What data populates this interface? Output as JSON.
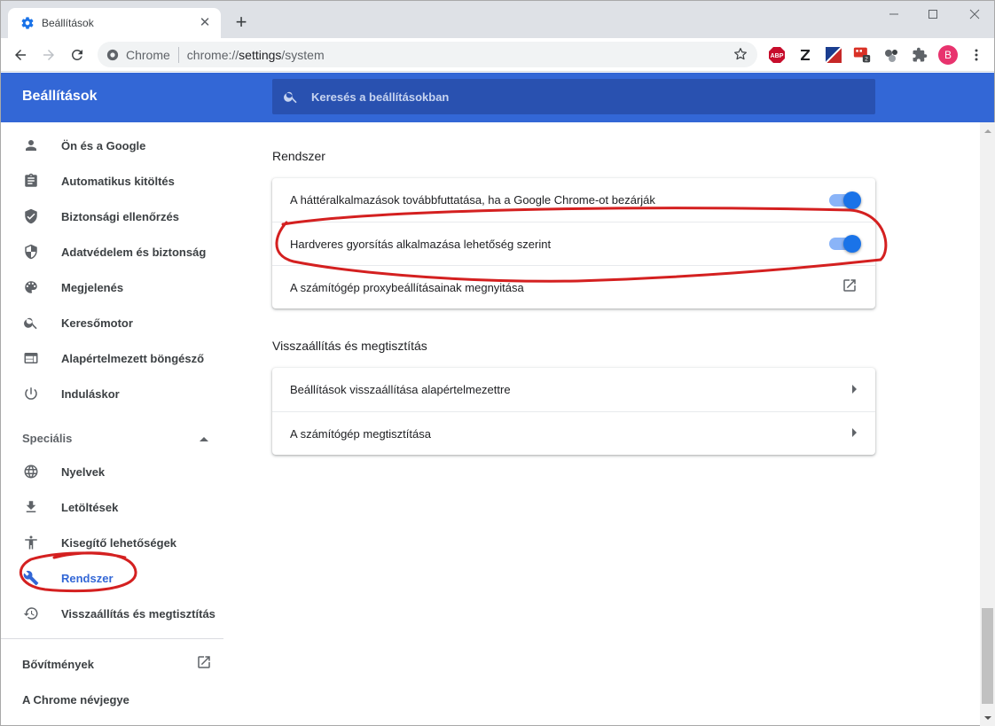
{
  "browser": {
    "tab_title": "Beállítások",
    "omnibox": {
      "site_label": "Chrome",
      "url_scheme": "chrome://",
      "url_host": "settings",
      "url_path": "/system"
    },
    "extensions": [
      "abp-icon",
      "zotero-icon",
      "flag-icon",
      "counter-icon",
      "dots-icon",
      "puzzle-icon"
    ],
    "ext_badge": "2",
    "avatar_letter": "B"
  },
  "header": {
    "title": "Beállítások",
    "search_placeholder": "Keresés a beállításokban"
  },
  "sidebar": {
    "items": [
      {
        "label": "Ön és a Google",
        "icon": "person-icon"
      },
      {
        "label": "Automatikus kitöltés",
        "icon": "clipboard-icon"
      },
      {
        "label": "Biztonsági ellenőrzés",
        "icon": "shield-check-icon"
      },
      {
        "label": "Adatvédelem és biztonság",
        "icon": "shield-icon"
      },
      {
        "label": "Megjelenés",
        "icon": "palette-icon"
      },
      {
        "label": "Keresőmotor",
        "icon": "search-icon"
      },
      {
        "label": "Alapértelmezett böngésző",
        "icon": "browser-icon"
      },
      {
        "label": "Induláskor",
        "icon": "power-icon"
      }
    ],
    "advanced_label": "Speciális",
    "advanced_items": [
      {
        "label": "Nyelvek",
        "icon": "globe-icon"
      },
      {
        "label": "Letöltések",
        "icon": "download-icon"
      },
      {
        "label": "Kisegítő lehetőségek",
        "icon": "accessibility-icon"
      },
      {
        "label": "Rendszer",
        "icon": "wrench-icon",
        "active": true
      },
      {
        "label": "Visszaállítás és megtisztítás",
        "icon": "history-icon"
      }
    ],
    "extensions_label": "Bővítmények",
    "about_label": "A Chrome névjegye"
  },
  "main": {
    "system": {
      "title": "Rendszer",
      "rows": [
        {
          "label": "A háttéralkalmazások továbbfuttatása, ha a Google Chrome-ot bezárják",
          "control": "toggle",
          "on": true
        },
        {
          "label": "Hardveres gyorsítás alkalmazása lehetőség szerint",
          "control": "toggle",
          "on": true
        },
        {
          "label": "A számítógép proxybeállításainak megnyitása",
          "control": "external-link"
        }
      ]
    },
    "reset": {
      "title": "Visszaállítás és megtisztítás",
      "rows": [
        {
          "label": "Beállítások visszaállítása alapértelmezettre",
          "control": "arrow"
        },
        {
          "label": "A számítógép megtisztítása",
          "control": "arrow"
        }
      ]
    }
  },
  "colors": {
    "header_blue": "#3367d6",
    "toggle_on": "#1a73e8",
    "annotation_red": "#d42020"
  }
}
